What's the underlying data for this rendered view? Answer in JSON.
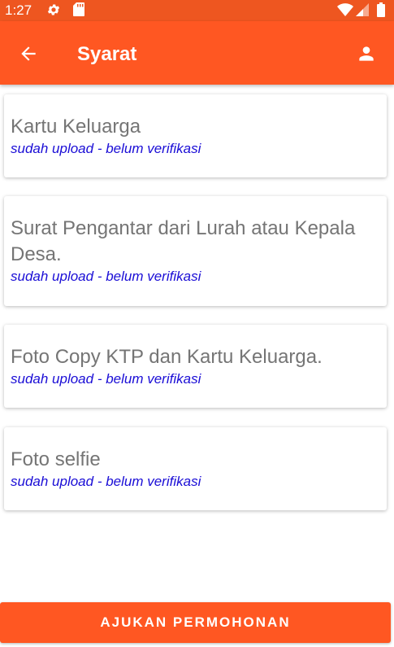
{
  "status_bar": {
    "time": "1:27"
  },
  "app_bar": {
    "title": "Syarat"
  },
  "requirements": [
    {
      "title": "Kartu Keluarga",
      "status": "sudah upload - belum verifikasi"
    },
    {
      "title": "Surat Pengantar dari Lurah atau Kepala Desa.",
      "status": "sudah upload - belum verifikasi"
    },
    {
      "title": "Foto Copy KTP dan Kartu Keluarga.",
      "status": "sudah upload - belum verifikasi"
    },
    {
      "title": "Foto selfie",
      "status": "sudah upload - belum verifikasi"
    }
  ],
  "submit_label": "AJUKAN PERMOHONAN",
  "colors": {
    "primary": "#ff5722",
    "status_text": "#1a0dd6",
    "title_text": "#757575"
  },
  "icons": {
    "status": [
      "gear-icon",
      "sd-card-icon",
      "wifi-icon",
      "signal-icon",
      "battery-icon"
    ],
    "app_bar": [
      "back-arrow-icon",
      "person-icon"
    ]
  }
}
